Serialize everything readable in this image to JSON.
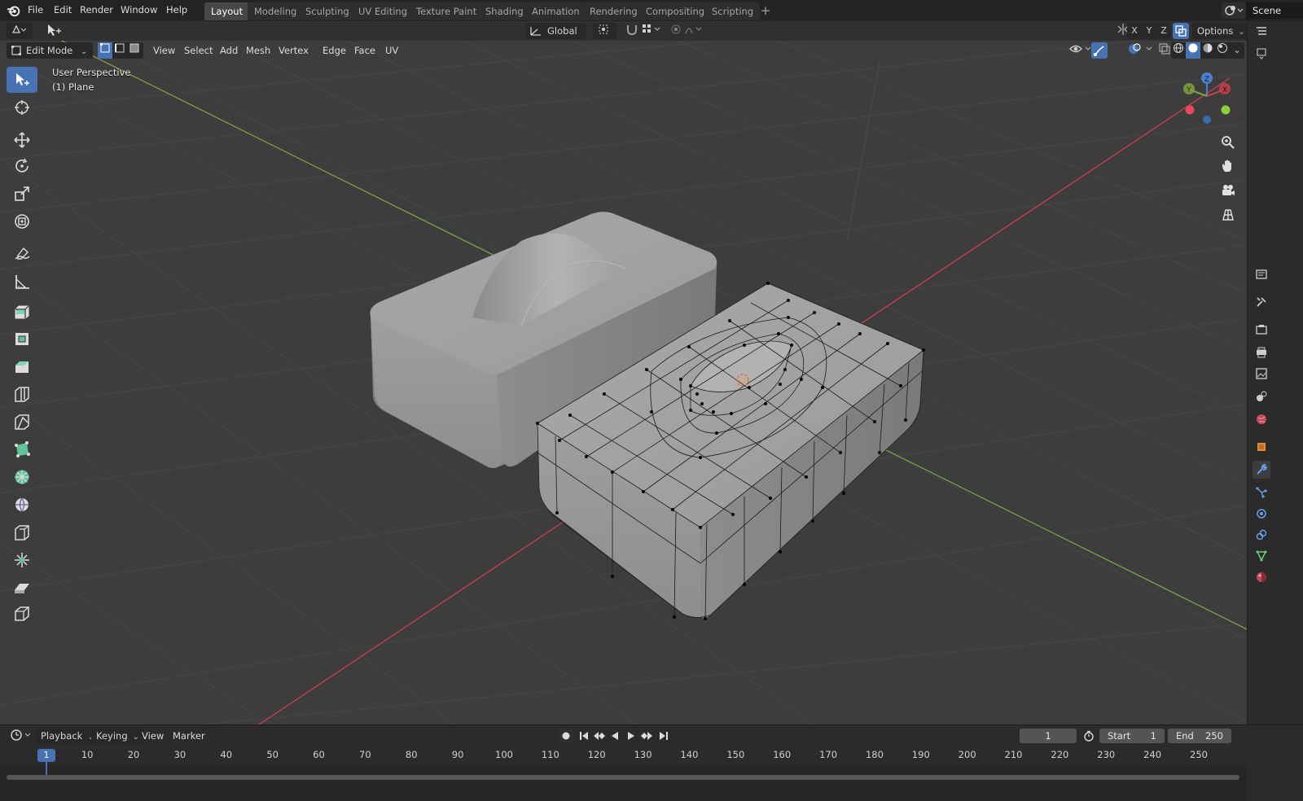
{
  "menu": [
    "File",
    "Edit",
    "Render",
    "Window",
    "Help"
  ],
  "workspaces": [
    {
      "label": "Layout",
      "active": true
    },
    {
      "label": "Modeling",
      "active": false
    },
    {
      "label": "Sculpting",
      "active": false
    },
    {
      "label": "UV Editing",
      "active": false
    },
    {
      "label": "Texture Paint",
      "active": false
    },
    {
      "label": "Shading",
      "active": false
    },
    {
      "label": "Animation",
      "active": false
    },
    {
      "label": "Rendering",
      "active": false
    },
    {
      "label": "Compositing",
      "active": false
    },
    {
      "label": "Scripting",
      "active": false
    }
  ],
  "scene_name": "Scene",
  "header": {
    "transform_orientation": "Global",
    "axis_x": "X",
    "axis_y": "Y",
    "axis_z": "Z",
    "options_label": "Options",
    "mode": "Edit Mode",
    "menus": [
      "View",
      "Select",
      "Add",
      "Mesh",
      "Vertex",
      "Edge",
      "Face",
      "UV"
    ]
  },
  "viewport": {
    "perspective_label": "User Perspective",
    "object_label": "(1) Plane",
    "gizmo": {
      "x": "X",
      "y": "Y",
      "z": "Z"
    },
    "colors": {
      "x_axis": "#c9404e",
      "y_axis": "#7ea33f",
      "accent": "#4772b3"
    }
  },
  "toolbar_tools": [
    "select-box-tool",
    "cursor-tool",
    "move-tool",
    "rotate-tool",
    "scale-tool",
    "transform-tool",
    "annotate-tool",
    "measure-tool",
    "extrude-region-tool",
    "inset-faces-tool",
    "bevel-tool",
    "loop-cut-tool",
    "knife-tool",
    "poly-build-tool",
    "spin-tool",
    "smooth-tool",
    "edge-slide-tool",
    "shrink-fatten-tool",
    "shear-tool",
    "rip-region-tool"
  ],
  "timeline": {
    "menus": [
      {
        "label": "Playback",
        "dropdown": true
      },
      {
        "label": "Keying",
        "dropdown": true
      },
      {
        "label": "View",
        "dropdown": false
      },
      {
        "label": "Marker",
        "dropdown": false
      }
    ],
    "current_frame": "1",
    "start_label": "Start",
    "start_value": "1",
    "end_label": "End",
    "end_value": "250",
    "ruler": [
      "10",
      "20",
      "30",
      "40",
      "50",
      "60",
      "70",
      "80",
      "90",
      "100",
      "110",
      "120",
      "130",
      "140",
      "150",
      "160",
      "170",
      "180",
      "190",
      "200",
      "210",
      "220",
      "230",
      "240",
      "250"
    ],
    "playhead_label": "1"
  }
}
